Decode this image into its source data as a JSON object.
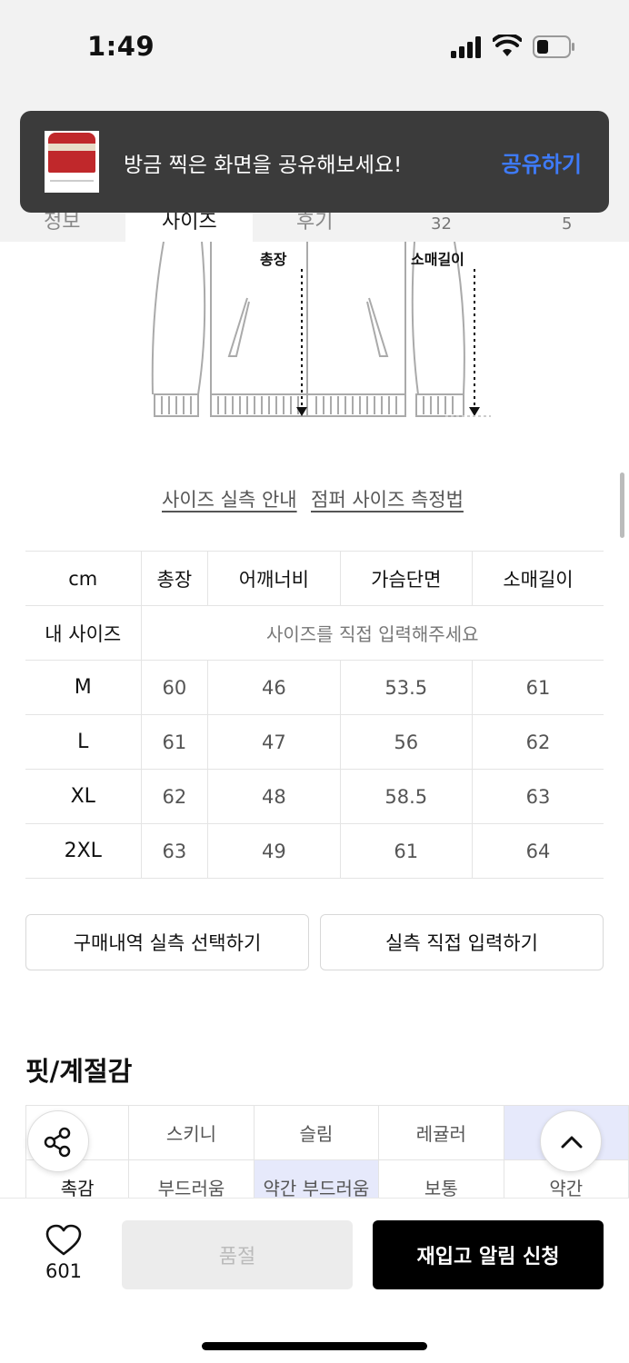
{
  "status": {
    "time": "1:49"
  },
  "tabs": {
    "tab1_partial": "정보",
    "tab2_partial": "사이즈",
    "tab3_partial": "후기",
    "num1": "32",
    "num2": "5"
  },
  "toast": {
    "message": "방금 찍은 화면을 공유해보세요!",
    "action": "공유하기"
  },
  "illustration": {
    "total_label": "총장",
    "sleeve_label": "소매길이"
  },
  "guide_links": {
    "size_guide": "사이즈 실측 안내",
    "measure_guide": "점퍼 사이즈 측정법"
  },
  "size_table": {
    "headers": [
      "cm",
      "총장",
      "어깨너비",
      "가슴단면",
      "소매길이"
    ],
    "my_size_label": "내 사이즈",
    "my_size_placeholder": "사이즈를 직접 입력해주세요",
    "rows": [
      {
        "size": "M",
        "values": [
          "60",
          "46",
          "53.5",
          "61"
        ]
      },
      {
        "size": "L",
        "values": [
          "61",
          "47",
          "56",
          "62"
        ]
      },
      {
        "size": "XL",
        "values": [
          "62",
          "48",
          "58.5",
          "63"
        ]
      },
      {
        "size": "2XL",
        "values": [
          "63",
          "49",
          "61",
          "64"
        ]
      }
    ]
  },
  "actions": {
    "purchase_history": "구매내역 실측 선택하기",
    "direct_input": "실측 직접 입력하기"
  },
  "fit": {
    "title": "핏/계절감",
    "row1": [
      "스키니",
      "슬림",
      "레귤러"
    ],
    "row2_label": "촉감",
    "row2": [
      "부드러움",
      "약간 부드러움",
      "보통",
      "약간"
    ]
  },
  "bottom": {
    "like_count": "601",
    "sold_out": "품절",
    "restock": "재입고 알림 신청"
  },
  "colors": {
    "accent_blue": "#3e7bfa",
    "highlight": "#e6e9fb",
    "primary_btn": "#000000"
  }
}
